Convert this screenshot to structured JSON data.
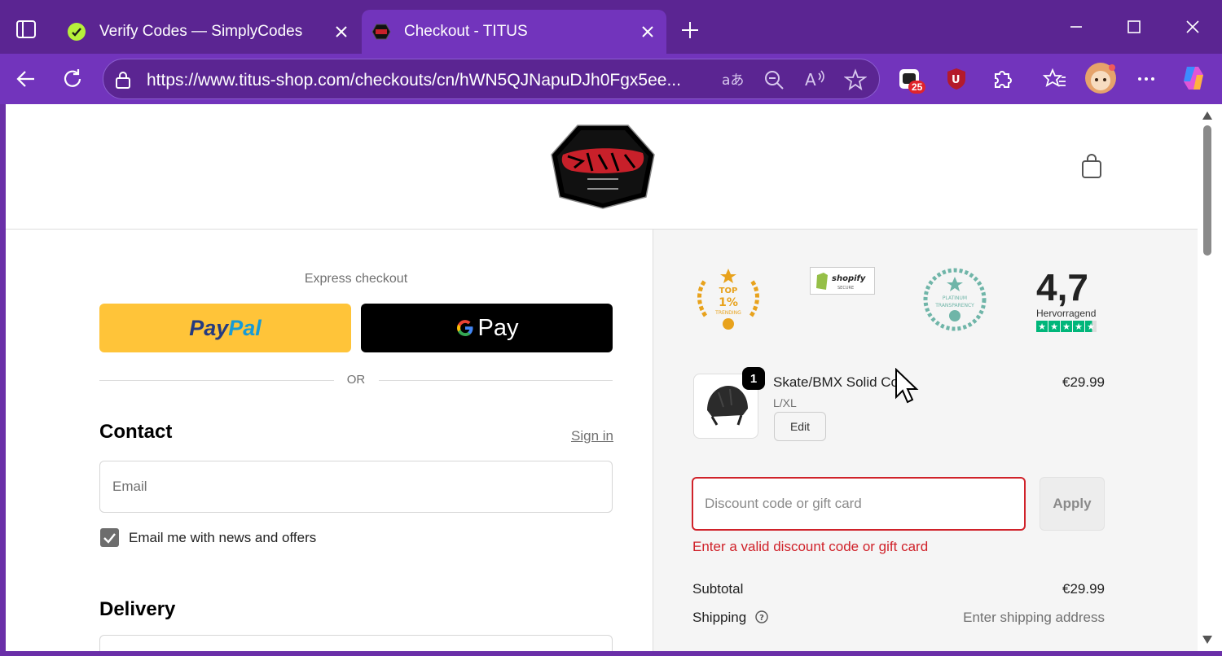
{
  "browser": {
    "tabs": [
      {
        "title": "Verify Codes — SimplyCodes",
        "active": false,
        "favicon": "simplycodes-icon"
      },
      {
        "title": "Checkout - TITUS",
        "active": true,
        "favicon": "titus-icon"
      }
    ],
    "url": "https://www.titus-shop.com/checkouts/cn/hWN5QJNapuDJh0Fgx5ee...",
    "extension_badge": "25"
  },
  "checkout": {
    "express_label": "Express checkout",
    "paypal": {
      "pay": "Pay",
      "pal": "Pal"
    },
    "gpay_label": "Pay",
    "or_label": "OR",
    "contact": {
      "title": "Contact",
      "signin": "Sign in",
      "email_placeholder": "Email",
      "newsletter_label": "Email me with news and offers",
      "newsletter_checked": true
    },
    "delivery_title": "Delivery"
  },
  "summary": {
    "rating": {
      "score": "4,7",
      "label": "Hervorragend",
      "stars": 4.5
    },
    "item": {
      "quantity": "1",
      "name": "Skate/BMX Solid Co",
      "variant": "L/XL",
      "edit_label": "Edit",
      "price": "€29.99"
    },
    "discount": {
      "placeholder": "Discount code or gift card",
      "apply_label": "Apply",
      "error": "Enter a valid discount code or gift card"
    },
    "subtotal_label": "Subtotal",
    "subtotal_value": "€29.99",
    "shipping_label": "Shipping",
    "shipping_value": "Enter shipping address"
  },
  "colors": {
    "browser_frame": "#5b2592",
    "browser_toolbar": "#7234bc",
    "paypal_yellow": "#ffc439",
    "error_red": "#d0222a",
    "trustpilot_green": "#00b67a"
  }
}
